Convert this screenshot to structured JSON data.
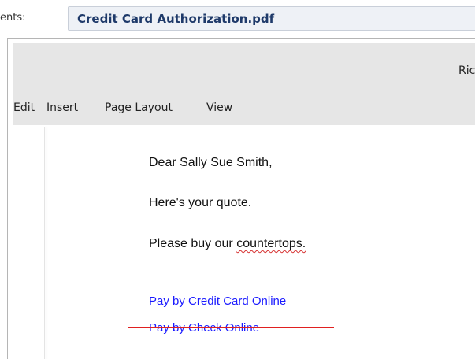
{
  "attachments": {
    "label": "ents:",
    "file_name": "Credit Card Authorization.pdf"
  },
  "ribbon": {
    "right_text": "Rich"
  },
  "menu": {
    "items": [
      "Edit",
      "Insert",
      "Page Layout",
      "View"
    ]
  },
  "document": {
    "greeting": "Dear Sally Sue Smith,",
    "line2": "Here's your quote.",
    "line3_prefix": "Please buy our ",
    "line3_misspelled": "countertops.",
    "links": [
      "Pay by Credit Card Online",
      "Pay by Check Online"
    ]
  },
  "colors": {
    "link": "#1a1aff",
    "strike": "#e02020",
    "ribbon_bg": "#e6e6e6",
    "attachment_text": "#1f3a6a"
  }
}
